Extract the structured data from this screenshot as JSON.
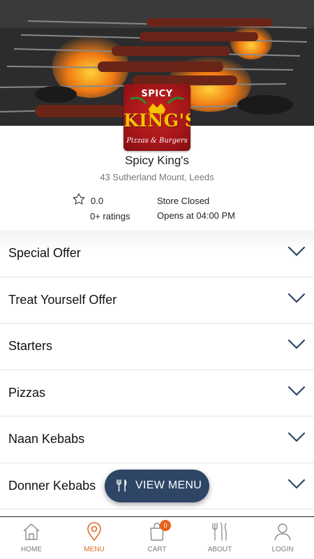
{
  "store": {
    "logo_top_text": "SPICY",
    "logo_main_text": "KING'S",
    "logo_sub_text": "Pizzas & Burgers",
    "name": "Spicy King's",
    "address": "43 Sutherland Mount, Leeds",
    "rating_value": "0.0",
    "rating_count": "0+ ratings",
    "status": "Store Closed",
    "opens": "Opens at 04:00 PM"
  },
  "categories": [
    {
      "label": "Special Offer"
    },
    {
      "label": "Treat Yourself Offer"
    },
    {
      "label": "Starters"
    },
    {
      "label": "Pizzas"
    },
    {
      "label": "Naan Kebabs"
    },
    {
      "label": "Donner Kebabs"
    }
  ],
  "view_menu": {
    "label": "VIEW MENU",
    "icon": "fork-knife-icon"
  },
  "bottom_nav": [
    {
      "label": "HOME",
      "icon": "home-icon",
      "active": false
    },
    {
      "label": "MENU",
      "icon": "location-pin-icon",
      "active": true
    },
    {
      "label": "CART",
      "icon": "shopping-bag-icon",
      "active": false,
      "badge": "0"
    },
    {
      "label": "ABOUT",
      "icon": "cutlery-icon",
      "active": false
    },
    {
      "label": "LOGIN",
      "icon": "user-icon",
      "active": false
    }
  ],
  "colors": {
    "accent": "#e06b2a",
    "badge": "#e8621b",
    "view_menu_bg": "#2e4566",
    "logo_bg": "#a4161a",
    "logo_gold": "#f7c200"
  }
}
